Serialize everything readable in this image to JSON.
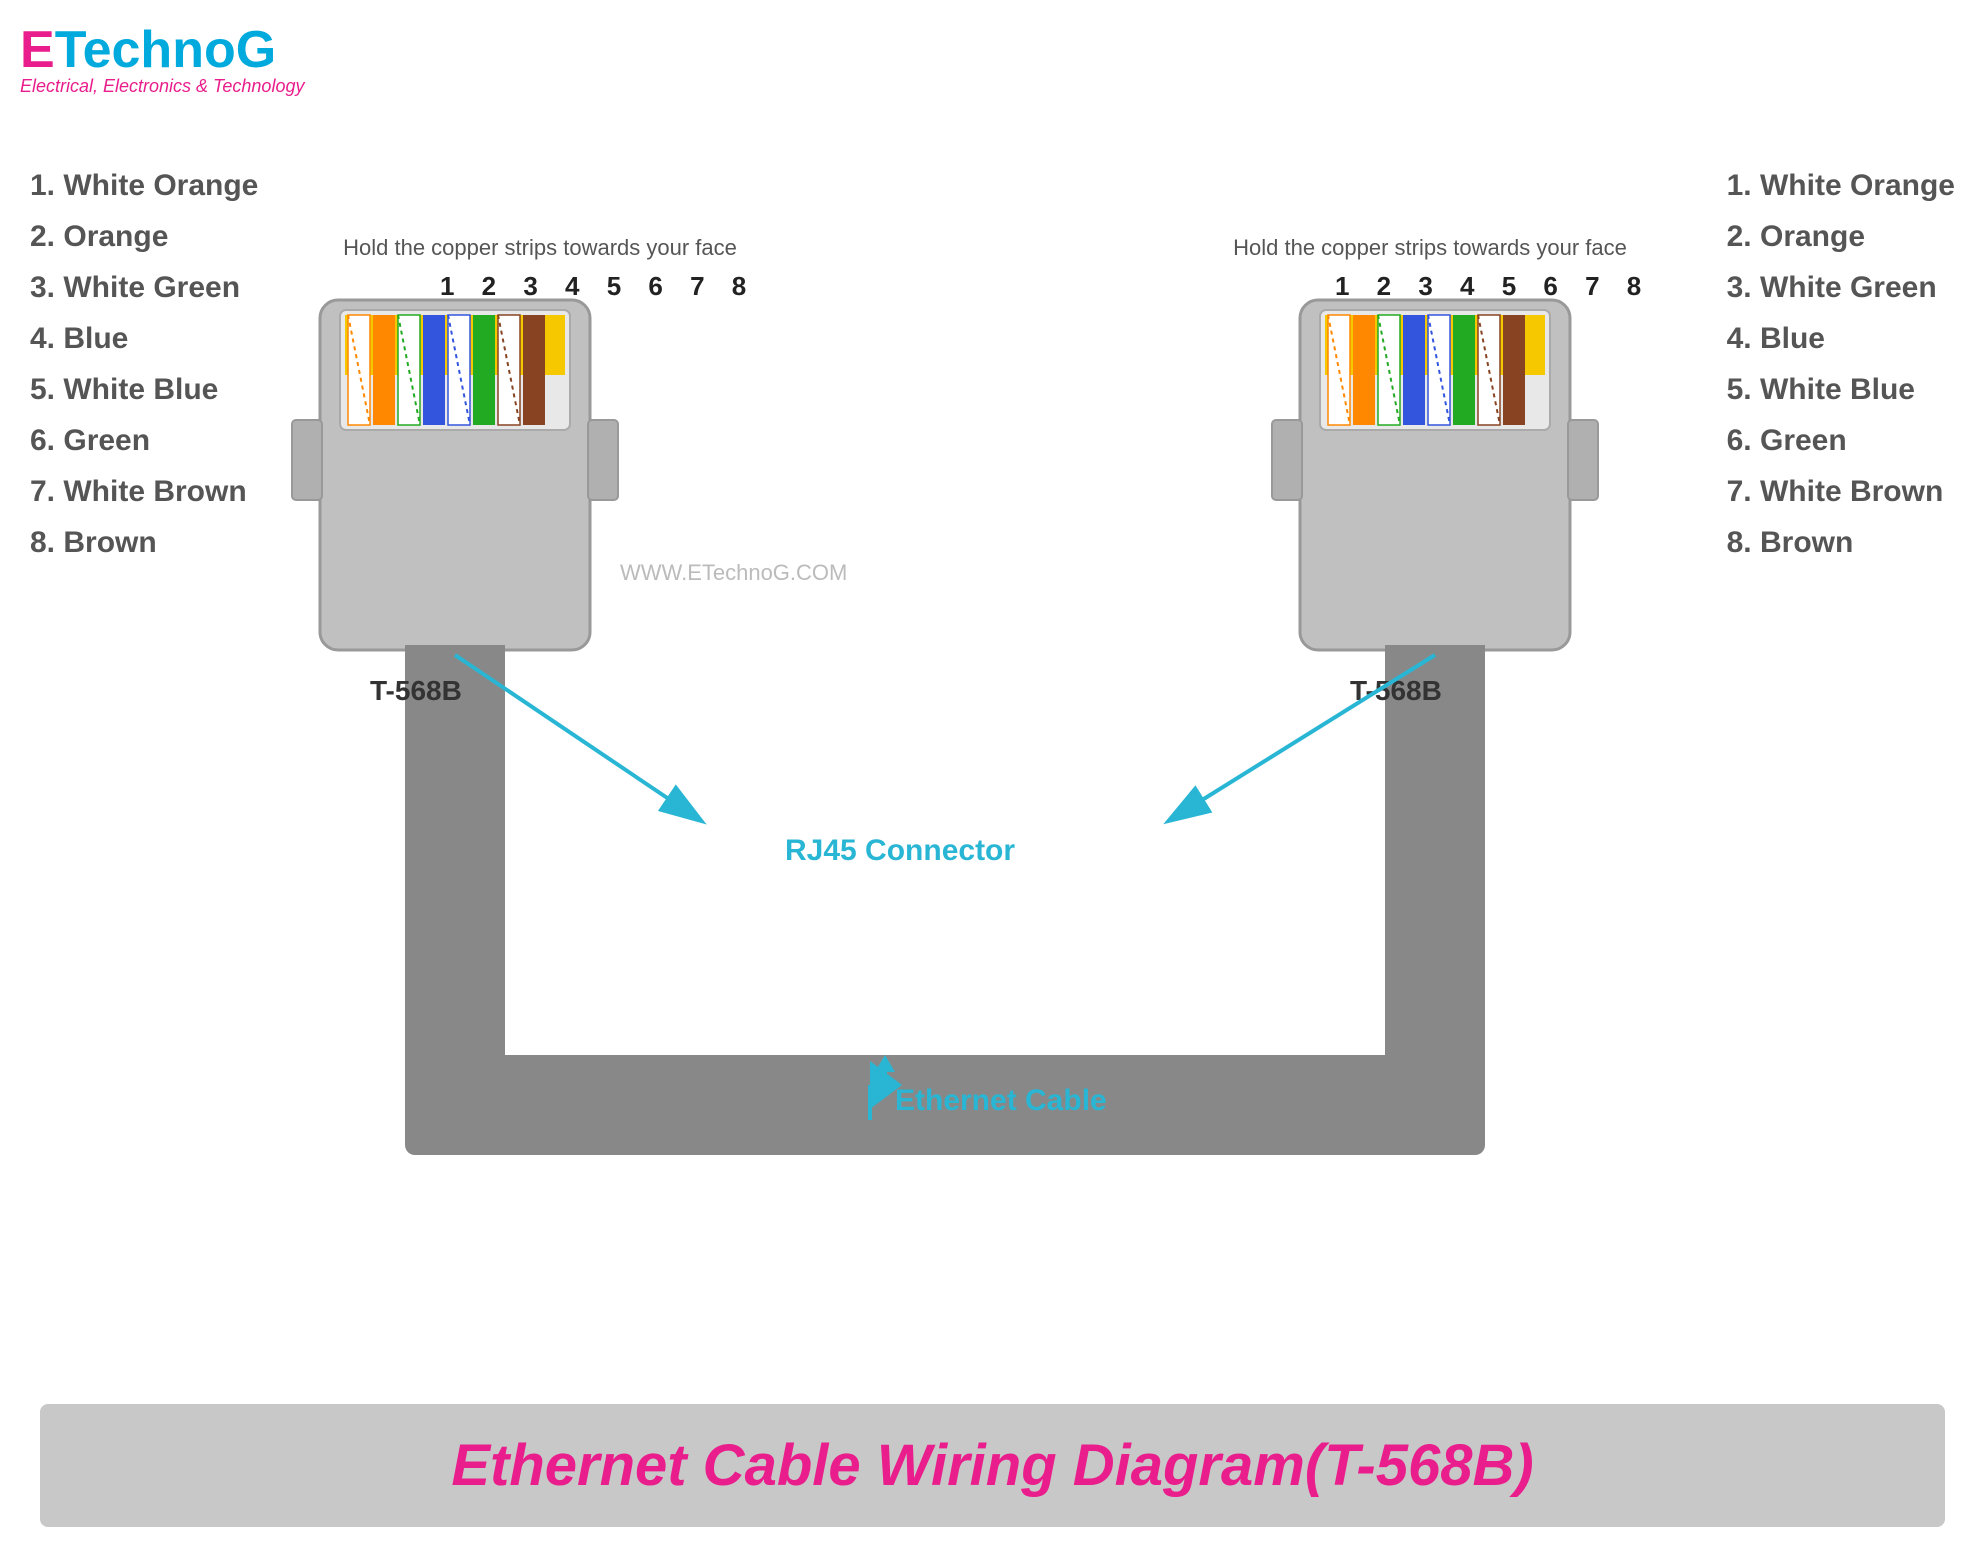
{
  "logo": {
    "e": "E",
    "technog": "TechnoG",
    "subtitle": "Electrical, Electronics & Technology"
  },
  "instruction": "Hold the copper strips towards your face",
  "pin_numbers": "1 2 3 4 5 6 7 8",
  "wire_list": [
    {
      "number": "1.",
      "label": "White Orange"
    },
    {
      "number": "2.",
      "label": "Orange"
    },
    {
      "number": "3.",
      "label": "White Green"
    },
    {
      "number": "4.",
      "label": "Blue"
    },
    {
      "number": "5.",
      "label": "White Blue"
    },
    {
      "number": "6.",
      "label": "Green"
    },
    {
      "number": "7.",
      "label": "White Brown"
    },
    {
      "number": "8.",
      "label": "Brown"
    }
  ],
  "connector_label": "T-568B",
  "rj45_label": "RJ45 Connector",
  "ethernet_label": "Ethernet Cable",
  "watermark": "WWW.ETechnoG.COM",
  "bottom_title": "Ethernet Cable Wiring Diagram(T-568B)",
  "colors": {
    "brand_pink": "#e91e8c",
    "brand_blue": "#00aadd",
    "arrow_cyan": "#29b6d4",
    "wire_white_orange": [
      "#ffffff",
      "#ff8800"
    ],
    "wire_orange": [
      "#ff8800"
    ],
    "wire_white_green": [
      "#ffffff",
      "#22aa22"
    ],
    "wire_blue": [
      "#3355dd"
    ],
    "wire_white_blue": [
      "#ffffff",
      "#3355dd"
    ],
    "wire_green": [
      "#22aa22"
    ],
    "wire_white_brown": [
      "#ffffff",
      "#884422"
    ],
    "wire_brown": [
      "#884422"
    ]
  }
}
